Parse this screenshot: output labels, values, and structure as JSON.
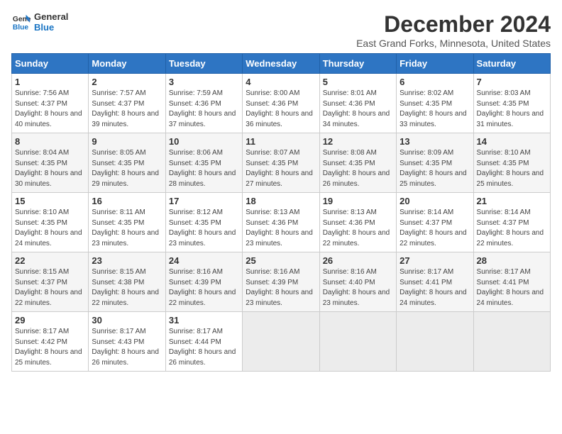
{
  "logo": {
    "line1": "General",
    "line2": "Blue"
  },
  "title": "December 2024",
  "subtitle": "East Grand Forks, Minnesota, United States",
  "days_of_week": [
    "Sunday",
    "Monday",
    "Tuesday",
    "Wednesday",
    "Thursday",
    "Friday",
    "Saturday"
  ],
  "weeks": [
    [
      {
        "day": "1",
        "sunrise": "Sunrise: 7:56 AM",
        "sunset": "Sunset: 4:37 PM",
        "daylight": "Daylight: 8 hours and 40 minutes."
      },
      {
        "day": "2",
        "sunrise": "Sunrise: 7:57 AM",
        "sunset": "Sunset: 4:37 PM",
        "daylight": "Daylight: 8 hours and 39 minutes."
      },
      {
        "day": "3",
        "sunrise": "Sunrise: 7:59 AM",
        "sunset": "Sunset: 4:36 PM",
        "daylight": "Daylight: 8 hours and 37 minutes."
      },
      {
        "day": "4",
        "sunrise": "Sunrise: 8:00 AM",
        "sunset": "Sunset: 4:36 PM",
        "daylight": "Daylight: 8 hours and 36 minutes."
      },
      {
        "day": "5",
        "sunrise": "Sunrise: 8:01 AM",
        "sunset": "Sunset: 4:36 PM",
        "daylight": "Daylight: 8 hours and 34 minutes."
      },
      {
        "day": "6",
        "sunrise": "Sunrise: 8:02 AM",
        "sunset": "Sunset: 4:35 PM",
        "daylight": "Daylight: 8 hours and 33 minutes."
      },
      {
        "day": "7",
        "sunrise": "Sunrise: 8:03 AM",
        "sunset": "Sunset: 4:35 PM",
        "daylight": "Daylight: 8 hours and 31 minutes."
      }
    ],
    [
      {
        "day": "8",
        "sunrise": "Sunrise: 8:04 AM",
        "sunset": "Sunset: 4:35 PM",
        "daylight": "Daylight: 8 hours and 30 minutes."
      },
      {
        "day": "9",
        "sunrise": "Sunrise: 8:05 AM",
        "sunset": "Sunset: 4:35 PM",
        "daylight": "Daylight: 8 hours and 29 minutes."
      },
      {
        "day": "10",
        "sunrise": "Sunrise: 8:06 AM",
        "sunset": "Sunset: 4:35 PM",
        "daylight": "Daylight: 8 hours and 28 minutes."
      },
      {
        "day": "11",
        "sunrise": "Sunrise: 8:07 AM",
        "sunset": "Sunset: 4:35 PM",
        "daylight": "Daylight: 8 hours and 27 minutes."
      },
      {
        "day": "12",
        "sunrise": "Sunrise: 8:08 AM",
        "sunset": "Sunset: 4:35 PM",
        "daylight": "Daylight: 8 hours and 26 minutes."
      },
      {
        "day": "13",
        "sunrise": "Sunrise: 8:09 AM",
        "sunset": "Sunset: 4:35 PM",
        "daylight": "Daylight: 8 hours and 25 minutes."
      },
      {
        "day": "14",
        "sunrise": "Sunrise: 8:10 AM",
        "sunset": "Sunset: 4:35 PM",
        "daylight": "Daylight: 8 hours and 25 minutes."
      }
    ],
    [
      {
        "day": "15",
        "sunrise": "Sunrise: 8:10 AM",
        "sunset": "Sunset: 4:35 PM",
        "daylight": "Daylight: 8 hours and 24 minutes."
      },
      {
        "day": "16",
        "sunrise": "Sunrise: 8:11 AM",
        "sunset": "Sunset: 4:35 PM",
        "daylight": "Daylight: 8 hours and 23 minutes."
      },
      {
        "day": "17",
        "sunrise": "Sunrise: 8:12 AM",
        "sunset": "Sunset: 4:35 PM",
        "daylight": "Daylight: 8 hours and 23 minutes."
      },
      {
        "day": "18",
        "sunrise": "Sunrise: 8:13 AM",
        "sunset": "Sunset: 4:36 PM",
        "daylight": "Daylight: 8 hours and 23 minutes."
      },
      {
        "day": "19",
        "sunrise": "Sunrise: 8:13 AM",
        "sunset": "Sunset: 4:36 PM",
        "daylight": "Daylight: 8 hours and 22 minutes."
      },
      {
        "day": "20",
        "sunrise": "Sunrise: 8:14 AM",
        "sunset": "Sunset: 4:37 PM",
        "daylight": "Daylight: 8 hours and 22 minutes."
      },
      {
        "day": "21",
        "sunrise": "Sunrise: 8:14 AM",
        "sunset": "Sunset: 4:37 PM",
        "daylight": "Daylight: 8 hours and 22 minutes."
      }
    ],
    [
      {
        "day": "22",
        "sunrise": "Sunrise: 8:15 AM",
        "sunset": "Sunset: 4:37 PM",
        "daylight": "Daylight: 8 hours and 22 minutes."
      },
      {
        "day": "23",
        "sunrise": "Sunrise: 8:15 AM",
        "sunset": "Sunset: 4:38 PM",
        "daylight": "Daylight: 8 hours and 22 minutes."
      },
      {
        "day": "24",
        "sunrise": "Sunrise: 8:16 AM",
        "sunset": "Sunset: 4:39 PM",
        "daylight": "Daylight: 8 hours and 22 minutes."
      },
      {
        "day": "25",
        "sunrise": "Sunrise: 8:16 AM",
        "sunset": "Sunset: 4:39 PM",
        "daylight": "Daylight: 8 hours and 23 minutes."
      },
      {
        "day": "26",
        "sunrise": "Sunrise: 8:16 AM",
        "sunset": "Sunset: 4:40 PM",
        "daylight": "Daylight: 8 hours and 23 minutes."
      },
      {
        "day": "27",
        "sunrise": "Sunrise: 8:17 AM",
        "sunset": "Sunset: 4:41 PM",
        "daylight": "Daylight: 8 hours and 24 minutes."
      },
      {
        "day": "28",
        "sunrise": "Sunrise: 8:17 AM",
        "sunset": "Sunset: 4:41 PM",
        "daylight": "Daylight: 8 hours and 24 minutes."
      }
    ],
    [
      {
        "day": "29",
        "sunrise": "Sunrise: 8:17 AM",
        "sunset": "Sunset: 4:42 PM",
        "daylight": "Daylight: 8 hours and 25 minutes."
      },
      {
        "day": "30",
        "sunrise": "Sunrise: 8:17 AM",
        "sunset": "Sunset: 4:43 PM",
        "daylight": "Daylight: 8 hours and 26 minutes."
      },
      {
        "day": "31",
        "sunrise": "Sunrise: 8:17 AM",
        "sunset": "Sunset: 4:44 PM",
        "daylight": "Daylight: 8 hours and 26 minutes."
      },
      null,
      null,
      null,
      null
    ]
  ]
}
